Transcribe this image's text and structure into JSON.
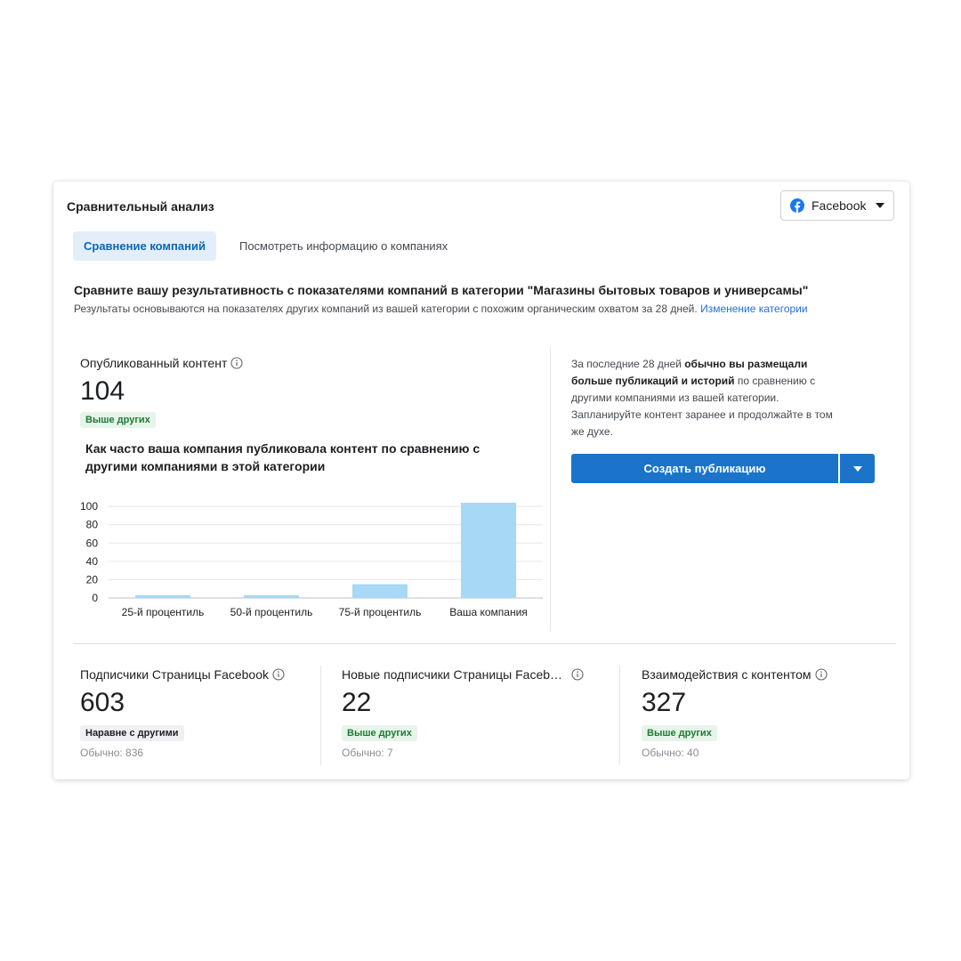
{
  "header": {
    "title": "Сравнительный анализ",
    "platform_select": {
      "label": "Facebook",
      "icon": "facebook-icon",
      "color": "#1877f2"
    }
  },
  "tabs": [
    {
      "label": "Сравнение компаний",
      "active": true
    },
    {
      "label": "Посмотреть информацию о компаниях",
      "active": false
    }
  ],
  "intro": {
    "heading": "Сравните вашу результативность с показателями компаний в категории \"Магазины бытовых товаров и универсамы\"",
    "description": "Результаты основываются на показателях других компаний из вашей категории с похожим органическим охватом за 28 дней.",
    "link": "Изменение категории"
  },
  "published": {
    "label": "Опубликованный контент",
    "value": "104",
    "badge": "Выше других",
    "chart_title": "Как часто ваша компания публиковала контент по сравнению с другими компаниями в этой категории"
  },
  "chart_data": {
    "type": "bar",
    "categories": [
      "25-й процентиль",
      "50-й процентиль",
      "75-й процентиль",
      "Ваша компания"
    ],
    "values": [
      3,
      3,
      15,
      104
    ],
    "yticks": [
      0,
      20,
      40,
      60,
      80,
      100
    ],
    "ylim": [
      0,
      105
    ],
    "bar_color": "#a7d8f5",
    "grid": true
  },
  "recommendation": {
    "text_1": "За последние 28 дней",
    "text_2": "обычно вы размещали больше публикаций и историй",
    "text_3": "по сравнению с другими компаниями из вашей категории. Запланируйте контент заранее и продолжайте в том же духе.",
    "button_label": "Создать публикацию",
    "accent": "#1b74c9"
  },
  "metrics": [
    {
      "label": "Подписчики Страницы Facebook",
      "value": "603",
      "badge": "Наравне с другими",
      "badge_type": "neutral",
      "typical": "Обычно: 836"
    },
    {
      "label": "Новые подписчики Страницы Faceb…",
      "value": "22",
      "badge": "Выше других",
      "badge_type": "positive",
      "typical": "Обычно: 7"
    },
    {
      "label": "Взаимодействия с контентом",
      "value": "327",
      "badge": "Выше других",
      "badge_type": "positive",
      "typical": "Обычно: 40"
    }
  ]
}
